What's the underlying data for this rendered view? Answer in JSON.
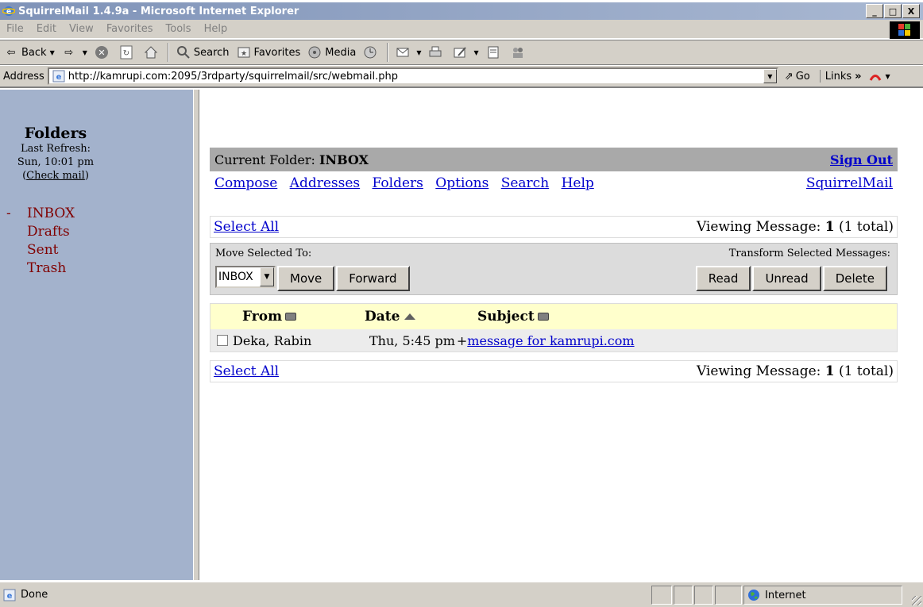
{
  "window": {
    "title": "SquirrelMail 1.4.9a - Microsoft Internet Explorer",
    "min": "_",
    "max": "□",
    "close": "X"
  },
  "menu": [
    "File",
    "Edit",
    "View",
    "Favorites",
    "Tools",
    "Help"
  ],
  "toolbar": {
    "back": "Back",
    "search": "Search",
    "favorites": "Favorites",
    "media": "Media"
  },
  "address": {
    "label": "Address",
    "url": "http://kamrupi.com:2095/3rdparty/squirrelmail/src/webmail.php",
    "go": "Go",
    "links": "Links"
  },
  "left": {
    "title": "Folders",
    "last_refresh_label": "Last Refresh:",
    "last_refresh_value": "Sun, 10:01 pm",
    "check_mail": "Check mail",
    "folders": [
      {
        "name": "INBOX",
        "prefix": "-"
      },
      {
        "name": "Drafts",
        "prefix": ""
      },
      {
        "name": "Sent",
        "prefix": ""
      },
      {
        "name": "Trash",
        "prefix": ""
      }
    ]
  },
  "main": {
    "current_folder_label": "Current Folder: ",
    "current_folder": "INBOX",
    "sign_out": "Sign Out",
    "nav": [
      "Compose",
      "Addresses",
      "Folders",
      "Options",
      "Search",
      "Help"
    ],
    "brand_link": "SquirrelMail",
    "select_all": "Select All",
    "viewing_label": "Viewing Message: ",
    "viewing_num": "1",
    "viewing_total": "(1 total)",
    "move_label": "Move Selected To:",
    "transform_label": "Transform Selected Messages:",
    "move_target": "INBOX",
    "move_button": "Move",
    "forward_button": "Forward",
    "read_button": "Read",
    "unread_button": "Unread",
    "delete_button": "Delete",
    "columns": [
      "From",
      "Date",
      "Subject"
    ],
    "messages": [
      {
        "from": "Deka, Rabin",
        "date": "Thu, 5:45 pm",
        "flag": "+",
        "subject": "message for kamrupi.com"
      }
    ]
  },
  "status": {
    "text": "Done",
    "zone": "Internet"
  },
  "colors": {
    "left_pane": "#a3b2cc",
    "link": "#0000cc",
    "folder": "#800000",
    "header_bar": "#a9a9a9",
    "table_header": "#ffffcc"
  }
}
